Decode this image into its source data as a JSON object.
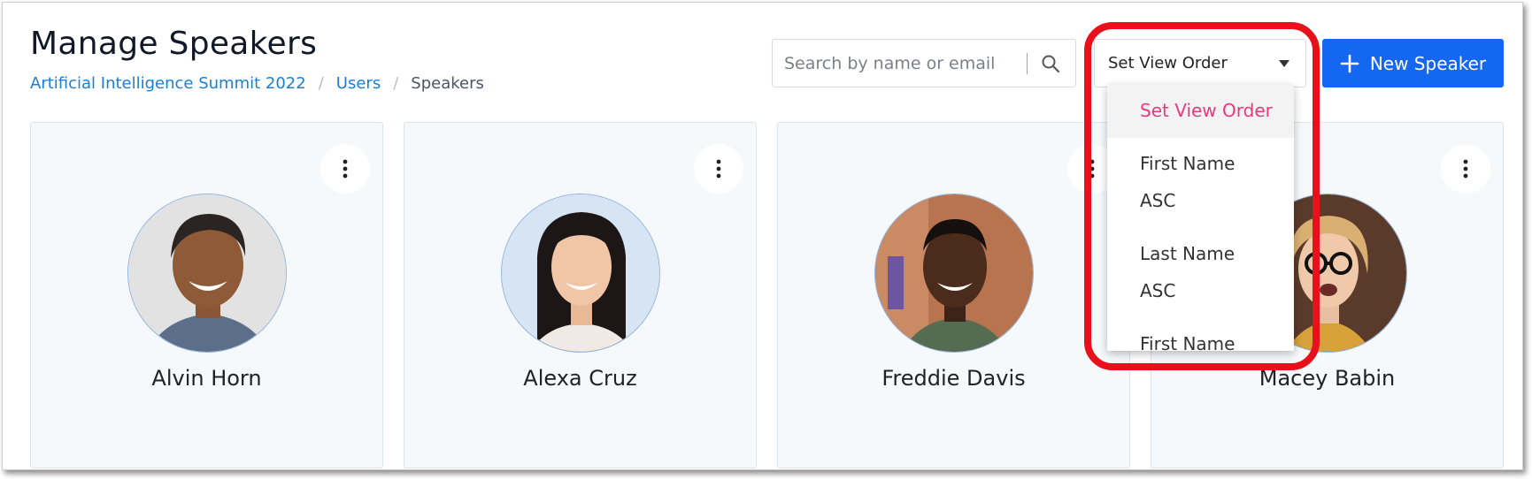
{
  "page": {
    "title": "Manage Speakers"
  },
  "breadcrumb": [
    {
      "label": "Artificial Intelligence Summit 2022"
    },
    {
      "label": "Users"
    },
    {
      "label": "Speakers"
    }
  ],
  "breadcrumb_separator": "/",
  "search": {
    "placeholder": "Search by name or email",
    "value": ""
  },
  "order_select": {
    "selected": "Set View Order",
    "options": [
      "Set View Order",
      "First Name ASC",
      "Last Name ASC",
      "First Name"
    ]
  },
  "new_speaker_button": {
    "label": "New Speaker"
  },
  "speakers": [
    {
      "name": "Alvin Horn"
    },
    {
      "name": "Alexa Cruz"
    },
    {
      "name": "Freddie Davis"
    },
    {
      "name": "Macey Babin"
    }
  ],
  "colors": {
    "primary": "#1467f0",
    "link": "#1b7fd6",
    "selected_option": "#e8397d",
    "highlight": "#e8101b"
  },
  "icons": [
    "search-icon",
    "plus-icon",
    "more-vertical-icon",
    "chevron-down-icon"
  ]
}
